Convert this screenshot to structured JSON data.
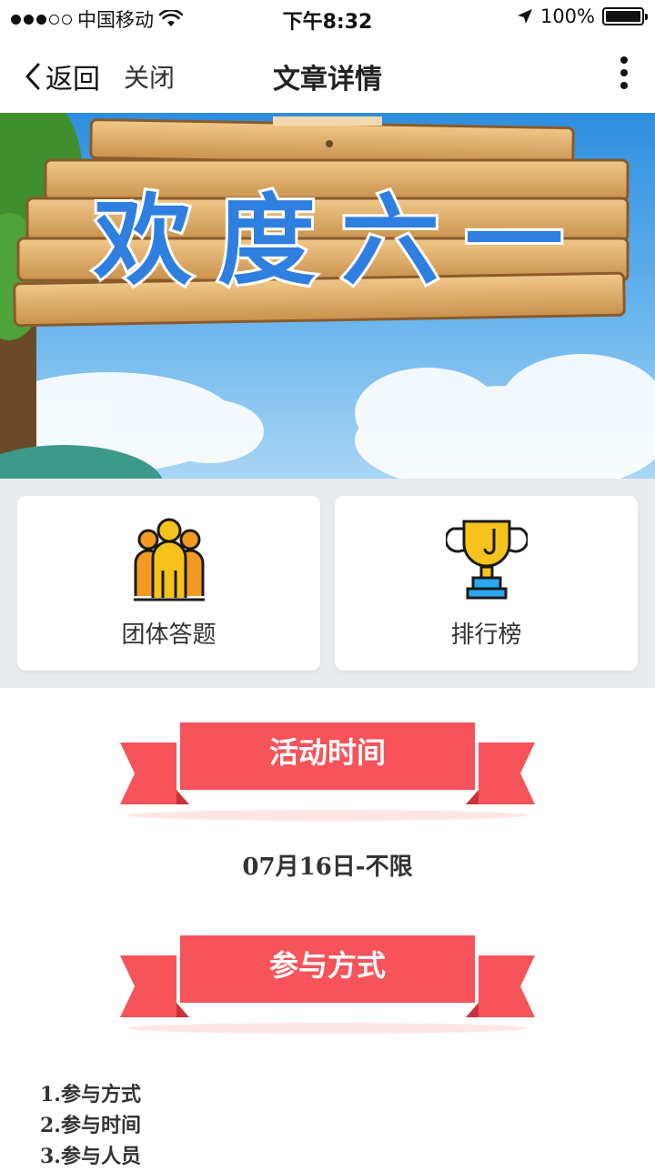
{
  "status_bar": {
    "carrier": "中国移动",
    "time": "下午8:32",
    "battery": "100%"
  },
  "nav": {
    "back_label": "返回",
    "close_label": "关闭",
    "title": "文章详情"
  },
  "banner": {
    "sign_text": "欢度六一"
  },
  "cards": [
    {
      "label": "团体答题",
      "icon": "group-people-icon"
    },
    {
      "label": "排行榜",
      "icon": "trophy-icon"
    }
  ],
  "section_time": {
    "heading": "活动时间",
    "value": "07月16日-不限"
  },
  "section_join": {
    "heading": "参与方式",
    "items": [
      "1.参与方式",
      "2.参与时间",
      "3.参与人员"
    ]
  },
  "colors": {
    "ribbon": "#f7535a",
    "ribbon_dark": "#d63b43",
    "cards_bg": "#e9ecef",
    "sky": "#4aa3e8"
  }
}
